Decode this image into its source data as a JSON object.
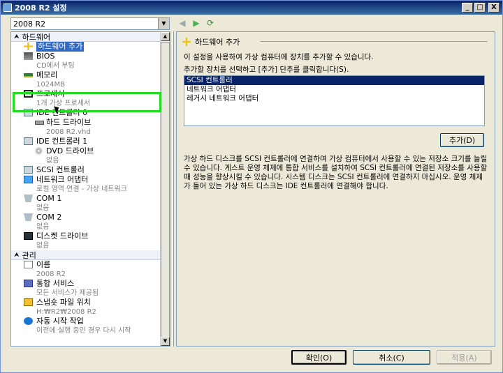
{
  "window": {
    "title": "2008 R2 설정",
    "minimize_glyph": "_",
    "maximize_glyph": "□",
    "close_glyph": "X"
  },
  "vm_selector": {
    "selected": "2008 R2"
  },
  "nav": {
    "back": "◀",
    "forward": "▶",
    "refresh": "⟳"
  },
  "tree": {
    "hardware_header": "하드웨어",
    "hardware_items": [
      {
        "icon": "add-hardware-icon",
        "label": "하드웨어 추가",
        "sub": ""
      },
      {
        "icon": "bios-icon",
        "label": "BIOS",
        "sub": "CD에서 부팅"
      },
      {
        "icon": "memory-icon",
        "label": "메모리",
        "sub": "1024MB"
      },
      {
        "icon": "processor-icon",
        "label": "프로세서",
        "sub": "1개 가상 프로세서"
      },
      {
        "icon": "ide-controller-icon",
        "label": "IDE 컨트롤러 0",
        "sub": ""
      },
      {
        "icon": "hard-drive-icon",
        "label": "하드 드라이브",
        "sub": "2008 R2.vhd"
      },
      {
        "icon": "ide-controller-icon",
        "label": "IDE 컨트롤러 1",
        "sub": ""
      },
      {
        "icon": "dvd-drive-icon",
        "label": "DVD 드라이브",
        "sub": "없음"
      },
      {
        "icon": "scsi-controller-icon",
        "label": "SCSI 컨트롤러",
        "sub": ""
      },
      {
        "icon": "network-adapter-icon",
        "label": "네트워크 어댑터",
        "sub": "로컬 영역 연결 - 가상 네트워크"
      },
      {
        "icon": "com-port-icon",
        "label": "COM 1",
        "sub": "없음"
      },
      {
        "icon": "com-port-icon",
        "label": "COM 2",
        "sub": "없음"
      },
      {
        "icon": "floppy-drive-icon",
        "label": "디스켓 드라이브",
        "sub": "없음"
      }
    ],
    "management_header": "관리",
    "management_items": [
      {
        "icon": "name-icon",
        "label": "이름",
        "sub": "2008 R2"
      },
      {
        "icon": "integration-services-icon",
        "label": "통합 서비스",
        "sub": "모든 서비스가 제공됨"
      },
      {
        "icon": "snapshot-icon",
        "label": "스냅숏 파일 위치",
        "sub": "H:₩R2₩2008 R2"
      },
      {
        "icon": "auto-start-icon",
        "label": "자동 시작 작업",
        "sub": "이전에 실행 중인 경우 다시 시작"
      }
    ]
  },
  "right": {
    "title": "하드웨어 추가",
    "desc1": "이 설정을 사용하여 가상 컴퓨터에 장치를 추가할 수 있습니다.",
    "desc2": "추가할 장치를 선택하고 [추가] 단추를 클릭합니다(S).",
    "devices": [
      "SCSI 컨트롤러",
      "네트워크 어댑터",
      "레거시 네트워크 어댑터"
    ],
    "selected_device_index": 0,
    "add_button": "추가(D)",
    "help": "가상 하드 디스크를 SCSI 컨트롤러에 연결하여 가상 컴퓨터에서 사용할 수 있는 저장소 크기를 늘릴 수 있습니다. 게스트 운영 체제에 통합 서비스를 설치하여 SCSI 컨트롤러에 연결된 저장소를 사용할 때 성능을 향상시킬 수 있습니다. 시스템 디스크는 SCSI 컨트롤러에 연결하지 마십시오. 운영 체제가 들어 있는 가상 하드 디스크는 IDE 컨트롤러에 연결해야 합니다."
  },
  "buttons": {
    "ok": "확인(O)",
    "cancel": "취소(C)",
    "apply": "적용(A)"
  }
}
